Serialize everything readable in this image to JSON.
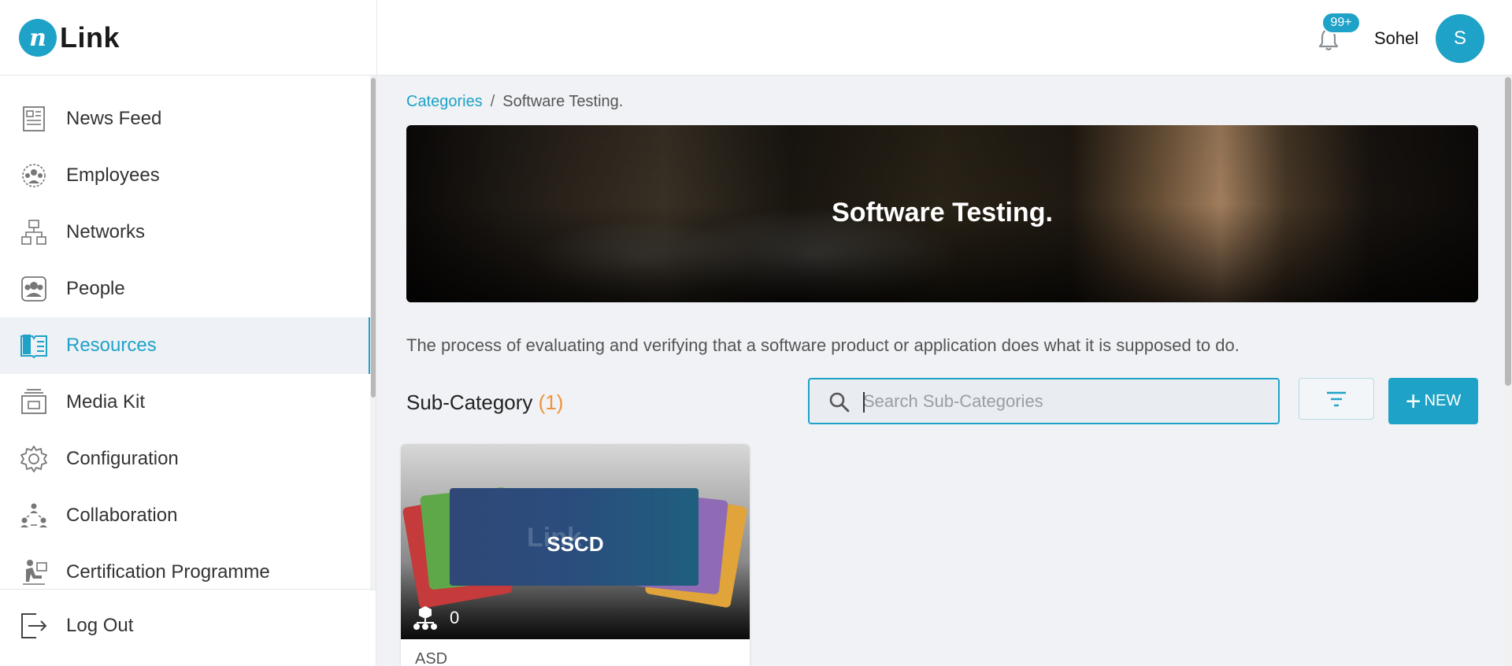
{
  "header": {
    "logo_mark": "n",
    "logo_text": "Link",
    "notification_count": "99+",
    "user_name": "Sohel",
    "avatar_initial": "S"
  },
  "sidebar": {
    "items": [
      {
        "label": "News Feed",
        "icon": "newspaper-icon",
        "active": false
      },
      {
        "label": "Employees",
        "icon": "employees-icon",
        "active": false
      },
      {
        "label": "Networks",
        "icon": "network-icon",
        "active": false
      },
      {
        "label": "People",
        "icon": "people-icon",
        "active": false
      },
      {
        "label": "Resources",
        "icon": "book-icon",
        "active": true
      },
      {
        "label": "Media Kit",
        "icon": "media-kit-icon",
        "active": false
      },
      {
        "label": "Configuration",
        "icon": "gear-icon",
        "active": false
      },
      {
        "label": "Collaboration",
        "icon": "collaboration-icon",
        "active": false
      },
      {
        "label": "Certification Programme",
        "icon": "certificate-icon",
        "active": false
      }
    ],
    "logout_label": "Log Out"
  },
  "breadcrumb": {
    "parent": "Categories",
    "separator": "/",
    "current": "Software Testing."
  },
  "banner": {
    "title": "Software Testing."
  },
  "description": "The process of evaluating and verifying that a software product or application does what it is supposed to do.",
  "subcategory": {
    "heading": "Sub-Category",
    "count": "(1)",
    "search_placeholder": "Search Sub-Categories",
    "search_value": "",
    "new_label": "NEW"
  },
  "cards": [
    {
      "title": "SSCD",
      "watermark": "Link",
      "member_count": "0",
      "footer": "ASD"
    }
  ],
  "colors": {
    "accent": "#1fa2c7",
    "count_orange": "#f0923b"
  }
}
